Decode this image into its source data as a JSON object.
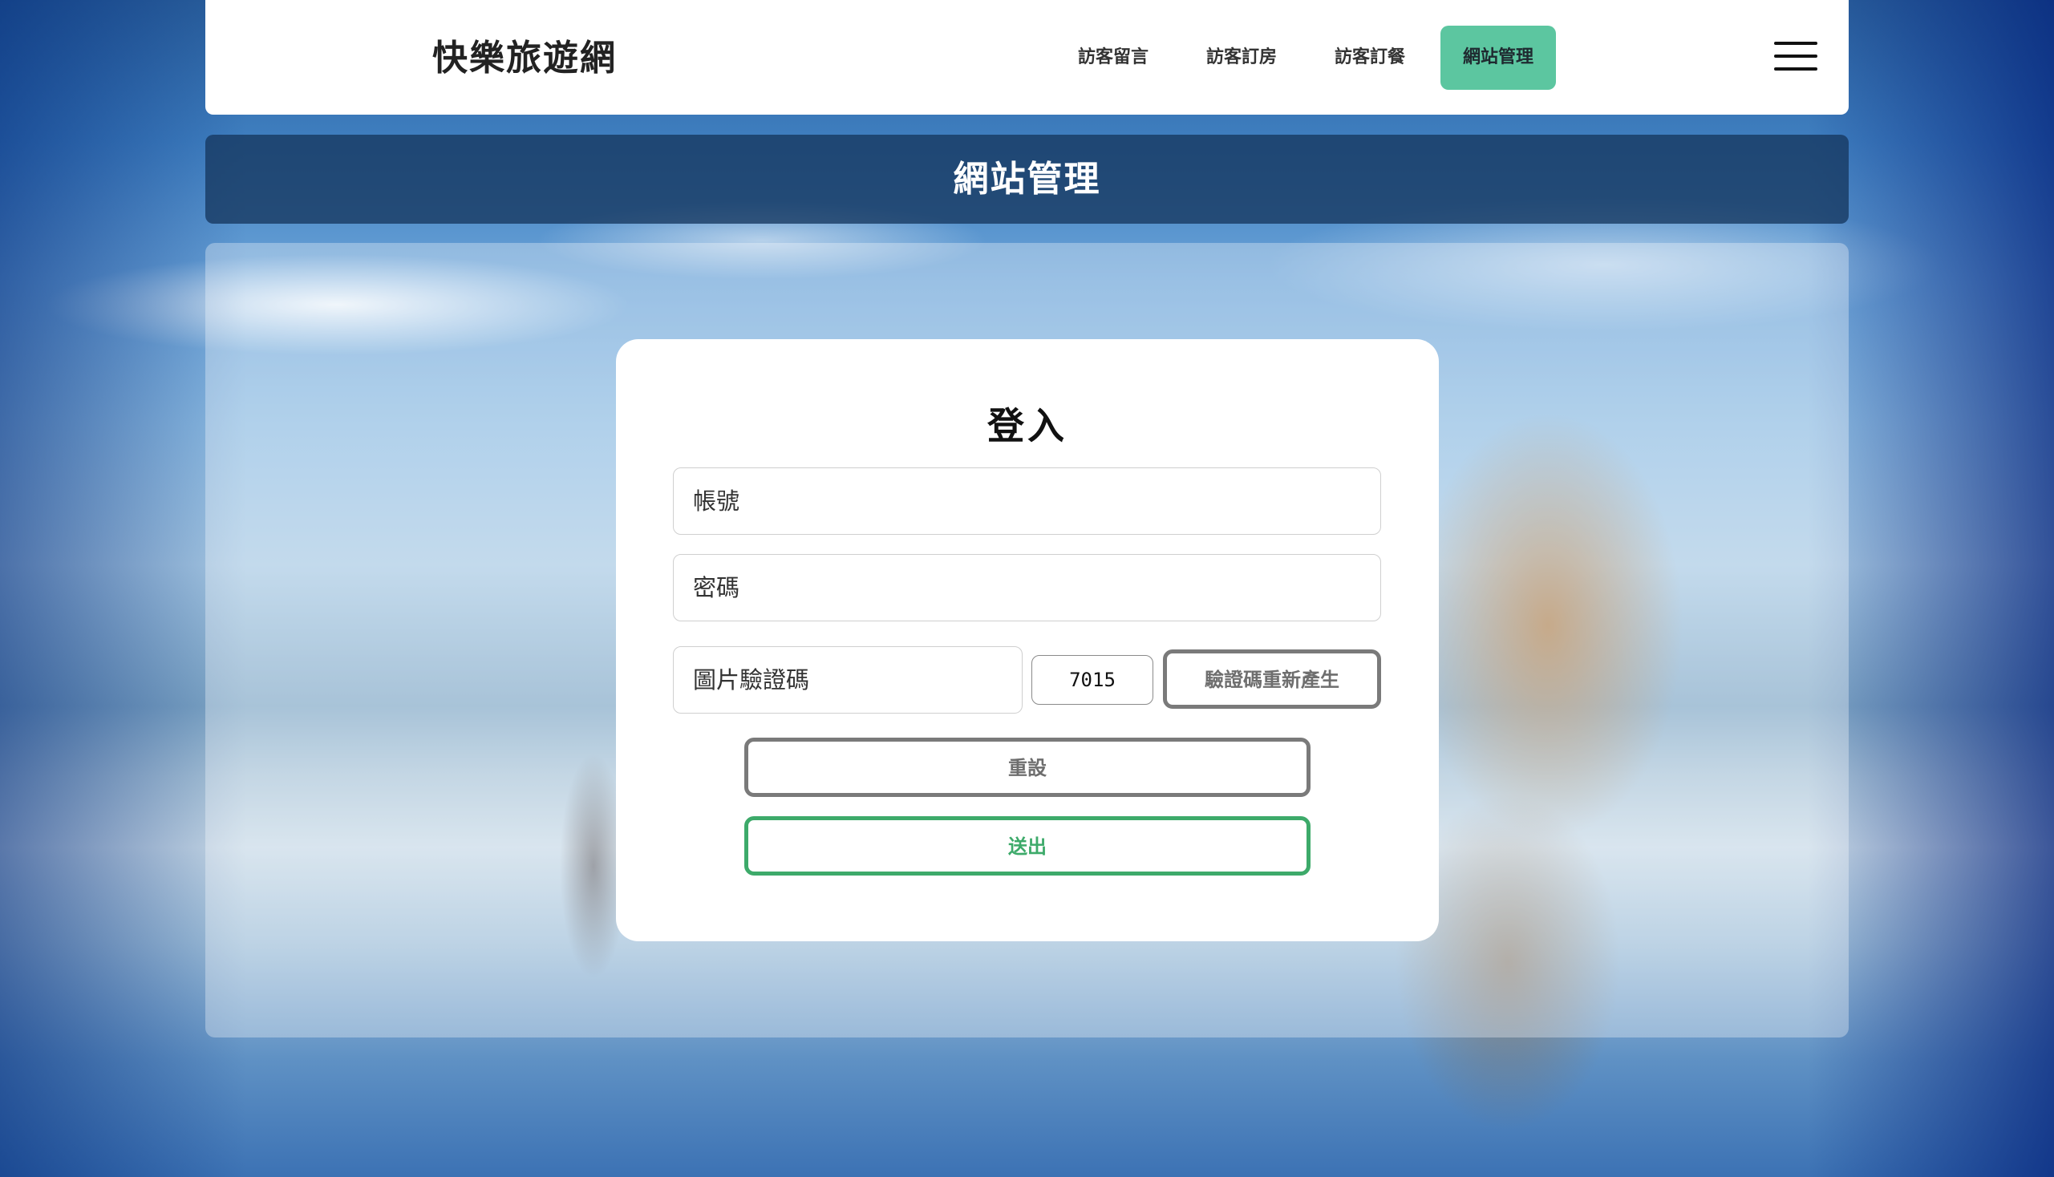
{
  "header": {
    "brand": "快樂旅遊網",
    "nav": [
      {
        "label": "訪客留言",
        "active": false
      },
      {
        "label": "訪客訂房",
        "active": false
      },
      {
        "label": "訪客訂餐",
        "active": false
      },
      {
        "label": "網站管理",
        "active": true
      }
    ],
    "menu_icon": "hamburger-menu-icon"
  },
  "page": {
    "title": "網站管理"
  },
  "login": {
    "title": "登入",
    "username_placeholder": "帳號",
    "username_value": "",
    "password_placeholder": "密碼",
    "password_value": "",
    "captcha_placeholder": "圖片驗證碼",
    "captcha_value": "",
    "captcha_code": "7015",
    "regenerate_label": "驗證碼重新產生",
    "reset_label": "重設",
    "submit_label": "送出"
  },
  "colors": {
    "active_nav_bg": "#5cc6a0",
    "title_bar_bg": "#16375f",
    "submit_accent": "#3daa6a",
    "neutral_button": "#7a7a7a"
  }
}
